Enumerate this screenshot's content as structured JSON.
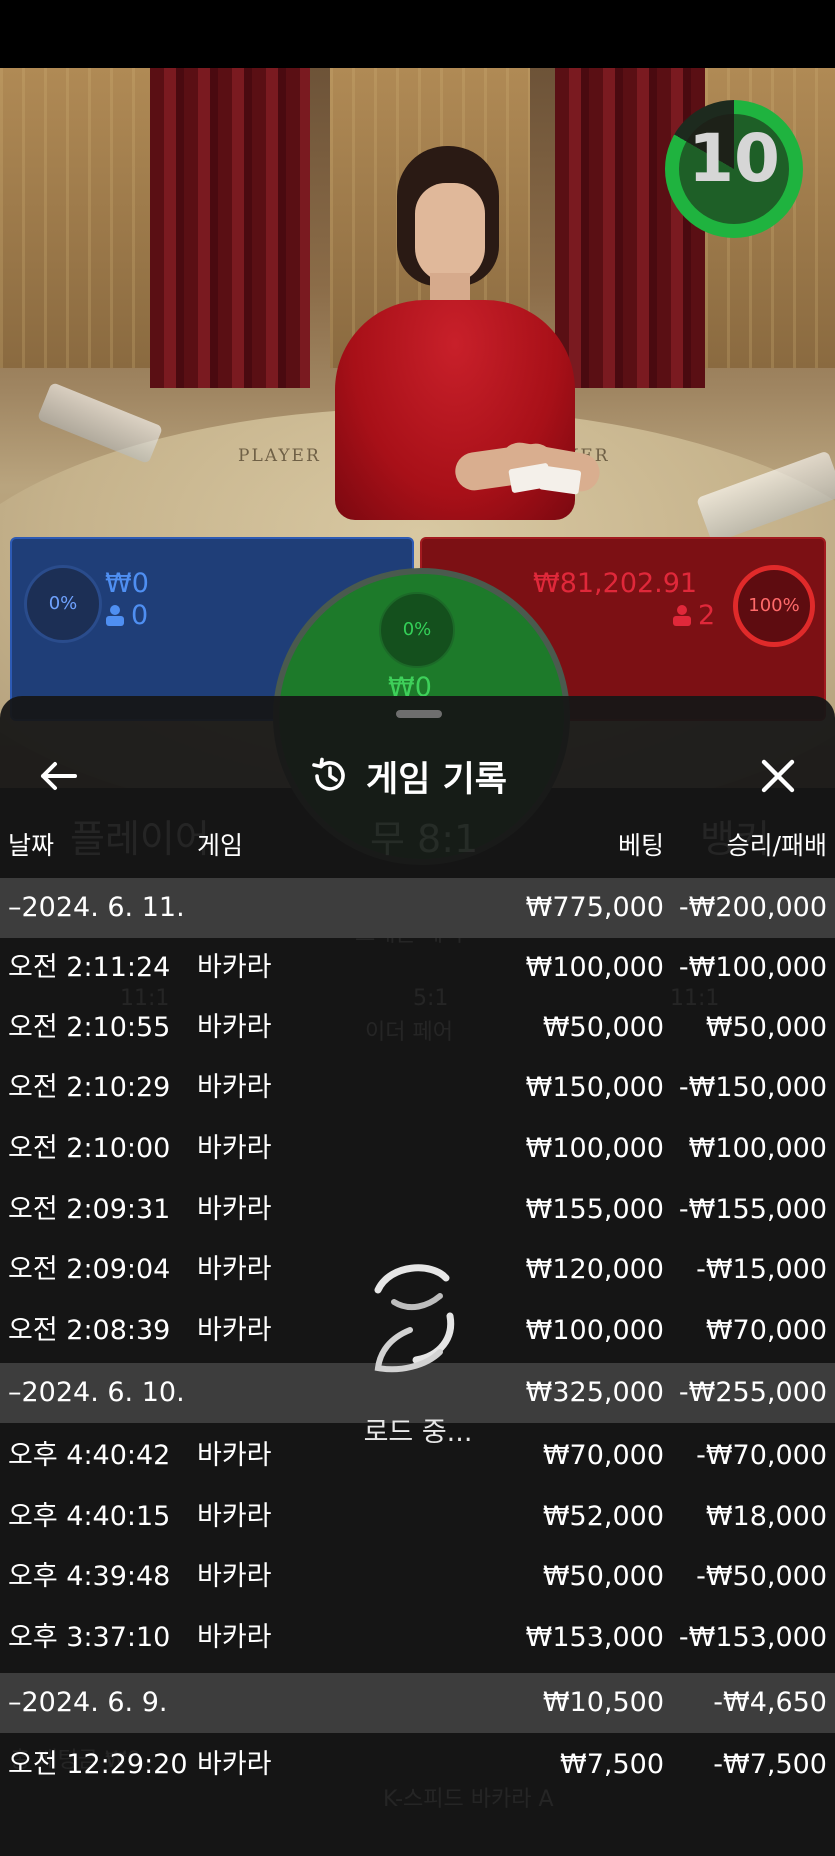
{
  "video": {
    "timer": "10",
    "table_labels": [
      "PLAYER",
      "BANKER"
    ]
  },
  "bets": {
    "player": {
      "percent": "0%",
      "amount": "₩0",
      "count": "0"
    },
    "tie": {
      "percent": "0%",
      "amount": "₩0"
    },
    "banker": {
      "percent": "100%",
      "amount": "₩81,202.91",
      "count": "2"
    }
  },
  "background_text": {
    "player_label": "플레이어",
    "tie_label": "무 8:1",
    "banker_label": "뱅커",
    "dragon_pay": "드래곤 페이",
    "either_pair": "이더 페어",
    "either_ratio": "5:1",
    "pair_ratio": "11:1",
    "total_bet": "총 배팅금 ₩0",
    "game_name": "K-스피드 바카라 A"
  },
  "sheet": {
    "title": "게임 기록",
    "columns": {
      "date": "날짜",
      "game": "게임",
      "bet": "베팅",
      "result": "승리/패배"
    },
    "rows": [
      {
        "type": "date",
        "time": "–2024. 6. 11.",
        "game": "",
        "bet": "₩775,000",
        "result": "-₩200,000"
      },
      {
        "type": "entry",
        "time": "오전 2:11:24",
        "game": "바카라",
        "bet": "₩100,000",
        "result": "-₩100,000"
      },
      {
        "type": "entry",
        "time": "오전 2:10:55",
        "game": "바카라",
        "bet": "₩50,000",
        "result": "₩50,000"
      },
      {
        "type": "entry",
        "time": "오전 2:10:29",
        "game": "바카라",
        "bet": "₩150,000",
        "result": "-₩150,000"
      },
      {
        "type": "entry",
        "time": "오전 2:10:00",
        "game": "바카라",
        "bet": "₩100,000",
        "result": "₩100,000"
      },
      {
        "type": "entry",
        "time": "오전 2:09:31",
        "game": "바카라",
        "bet": "₩155,000",
        "result": "-₩155,000"
      },
      {
        "type": "entry",
        "time": "오전 2:09:04",
        "game": "바카라",
        "bet": "₩120,000",
        "result": "-₩15,000"
      },
      {
        "type": "entry",
        "time": "오전 2:08:39",
        "game": "바카라",
        "bet": "₩100,000",
        "result": "₩70,000"
      },
      {
        "type": "date",
        "time": "–2024. 6. 10.",
        "game": "",
        "bet": "₩325,000",
        "result": "-₩255,000"
      },
      {
        "type": "entry",
        "time": "오후 4:40:42",
        "game": "바카라",
        "bet": "₩70,000",
        "result": "-₩70,000"
      },
      {
        "type": "entry",
        "time": "오후 4:40:15",
        "game": "바카라",
        "bet": "₩52,000",
        "result": "₩18,000"
      },
      {
        "type": "entry",
        "time": "오후 4:39:48",
        "game": "바카라",
        "bet": "₩50,000",
        "result": "-₩50,000"
      },
      {
        "type": "entry",
        "time": "오후 3:37:10",
        "game": "바카라",
        "bet": "₩153,000",
        "result": "-₩153,000"
      },
      {
        "type": "date",
        "time": "–2024. 6. 9.",
        "game": "",
        "bet": "₩10,500",
        "result": "-₩4,650"
      },
      {
        "type": "entry",
        "time": "오전 12:29:20",
        "game": "바카라",
        "bet": "₩7,500",
        "result": "-₩7,500"
      }
    ],
    "loading_text": "로드 중..."
  },
  "icons": {
    "back": "arrow-left-icon",
    "history": "history-clock-icon",
    "close": "close-icon",
    "loading": "loading-spinner-icon"
  }
}
